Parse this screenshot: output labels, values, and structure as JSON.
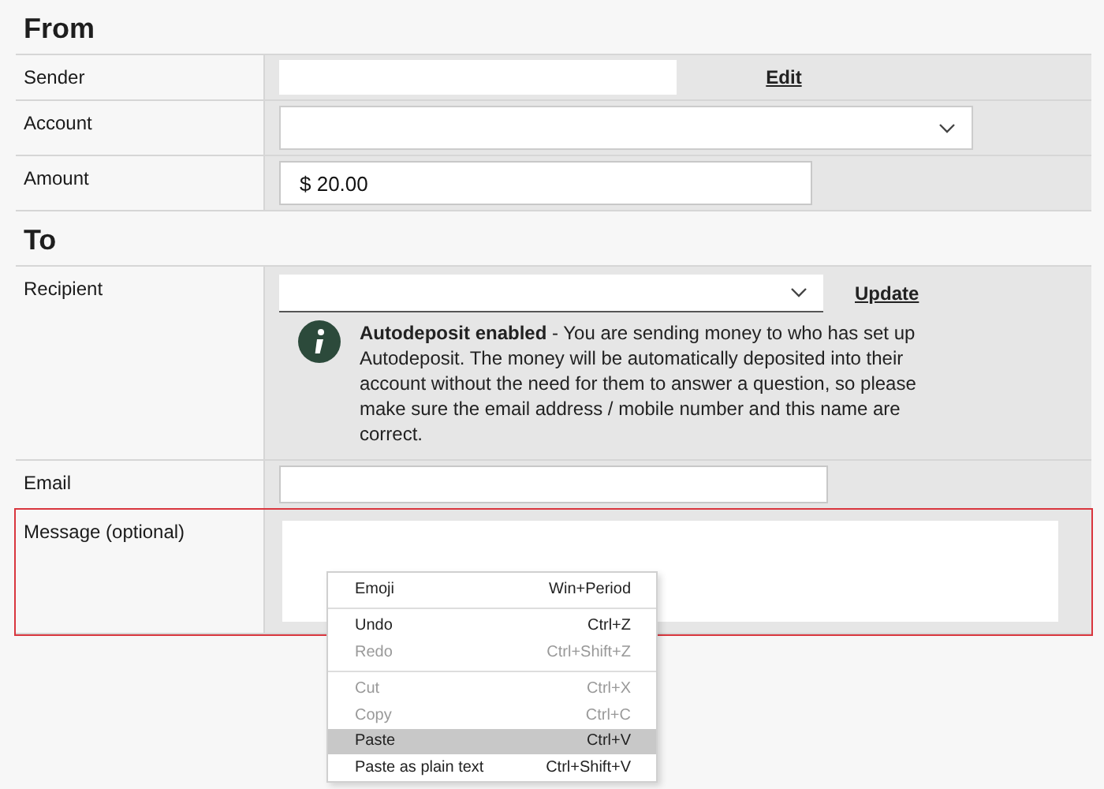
{
  "sections": [
    {
      "title": "From",
      "rows": [
        {
          "kind": "text",
          "label": "Sender",
          "link": "Edit"
        },
        {
          "kind": "select",
          "label": "Account"
        },
        {
          "kind": "input",
          "label": "Amount",
          "value": "$ 20.00"
        }
      ]
    },
    {
      "title": "To",
      "rows": [
        {
          "kind": "recipient",
          "label": "Recipient",
          "link": "Update",
          "notice": "**Autodeposit enabled** - You are sending money to who has set up Autodeposit. The money will be automatically deposited into their account without the need for them to answer a question, so please make sure the email address / mobile number and this name are correct."
        },
        {
          "kind": "input",
          "label": "Email"
        },
        {
          "kind": "textarea",
          "label": "Message (optional)",
          "highlighted": true
        }
      ]
    }
  ],
  "context_menu": {
    "groups": [
      [
        {
          "label": "Emoji",
          "shortcut": "Win+Period",
          "disabled": false,
          "selected": false
        }
      ],
      [
        {
          "label": "Undo",
          "shortcut": "Ctrl+Z",
          "disabled": false,
          "selected": false
        },
        {
          "label": "Redo",
          "shortcut": "Ctrl+Shift+Z",
          "disabled": true,
          "selected": false
        }
      ],
      [
        {
          "label": "Cut",
          "shortcut": "Ctrl+X",
          "disabled": true,
          "selected": false
        },
        {
          "label": "Copy",
          "shortcut": "Ctrl+C",
          "disabled": true,
          "selected": false
        },
        {
          "label": "Paste",
          "shortcut": "Ctrl+V",
          "disabled": false,
          "selected": true
        },
        {
          "label": "Paste as plain text",
          "shortcut": "Ctrl+Shift+V",
          "disabled": false,
          "selected": false
        }
      ]
    ]
  }
}
